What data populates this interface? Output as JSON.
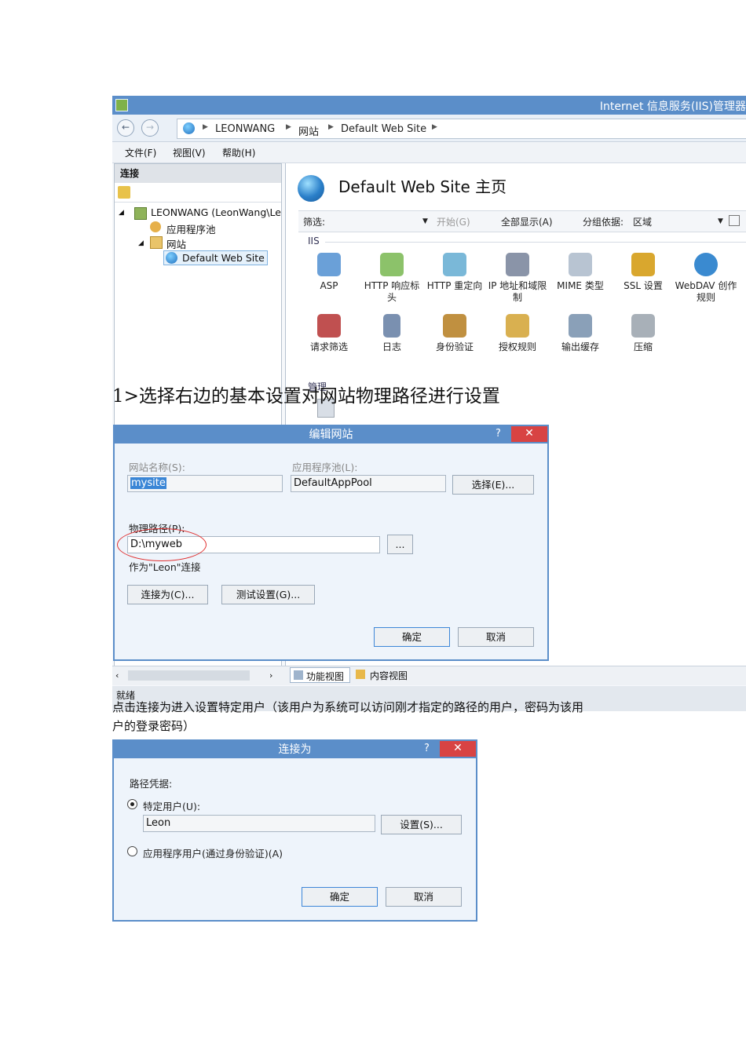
{
  "iis_window": {
    "title": "Internet 信息服务(IIS)管理器",
    "breadcrumb": [
      "LEONWANG",
      "网站",
      "Default Web Site"
    ],
    "menu": [
      "文件(F)",
      "视图(V)",
      "帮助(H)"
    ],
    "left_header": "连接",
    "tree": [
      "LEONWANG (LeonWang\\Le",
      "应用程序池",
      "网站",
      "Default Web Site"
    ],
    "home_title": "Default Web Site 主页",
    "filter": {
      "label": "筛选:",
      "start": "开始(G)",
      "show_all": "全部显示(A)",
      "group_label": "分组依据:",
      "group_value": "区域"
    },
    "section_iis": "IIS",
    "section_manage": "管理",
    "features_row1": [
      "ASP",
      "HTTP 响应标头",
      "HTTP 重定向",
      "IP 地址和域限制",
      "MIME 类型",
      "SSL 设置",
      "WebDAV 创作规则"
    ],
    "features_row2": [
      "请求筛选",
      "日志",
      "身份验证",
      "授权规则",
      "输出缓存",
      "压缩"
    ],
    "view_tabs": [
      "功能视图",
      "内容视图"
    ],
    "status": "就绪"
  },
  "para1": "1>选择右边的基本设置对网站物理路径进行设置",
  "edit_dialog": {
    "title": "编辑网站",
    "help": "?",
    "close": "✕",
    "site_name_label": "网站名称(S):",
    "site_name_value": "mysite",
    "app_pool_label": "应用程序池(L):",
    "app_pool_value": "DefaultAppPool",
    "select_button": "选择(E)...",
    "path_label": "物理路径(P):",
    "path_value": "D:\\myweb",
    "browse_button": "...",
    "connect_as_text": "作为\"Leon\"连接",
    "connect_button": "连接为(C)...",
    "test_button": "测试设置(G)...",
    "ok": "确定",
    "cancel": "取消"
  },
  "para2_line1": "点击连接为进入设置特定用户（该用户为系统可以访问刚才指定的路径的用户，密码为该用",
  "para2_line2": "户的登录密码）",
  "connect_dialog": {
    "title": "连接为",
    "help": "?",
    "close": "✕",
    "credentials_label": "路径凭据:",
    "specific_user_label": "特定用户(U):",
    "user_value": "Leon",
    "set_button": "设置(S)...",
    "app_user_label": "应用程序用户(通过身份验证)(A)",
    "ok": "确定",
    "cancel": "取消"
  },
  "colors": {
    "title_blue": "#5b8ec9",
    "close_red": "#d84343",
    "highlight_circle": "#e03030"
  }
}
